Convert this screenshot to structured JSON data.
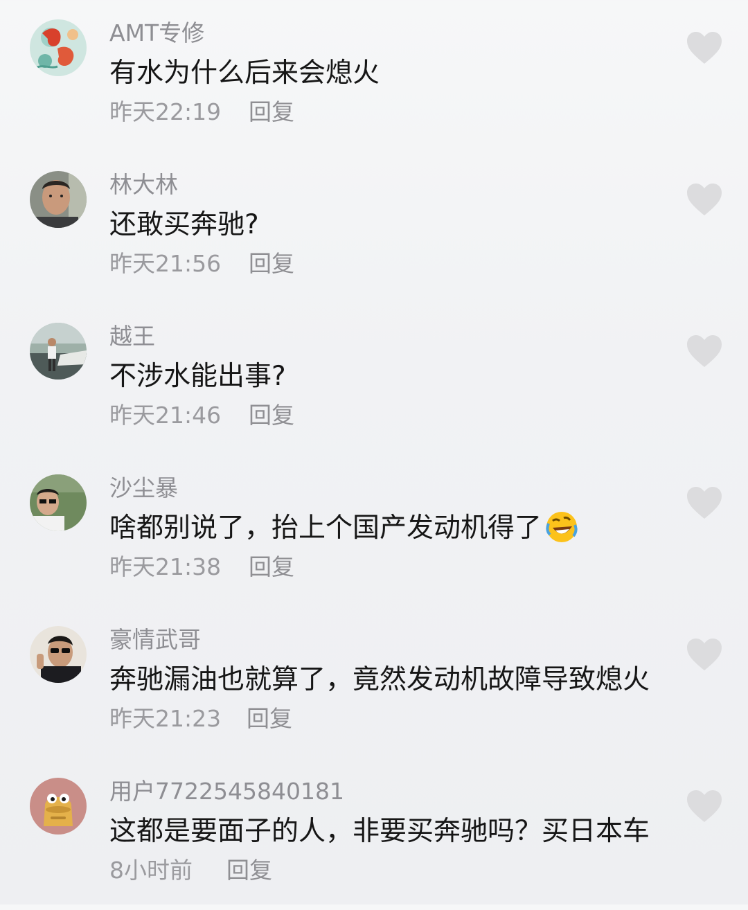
{
  "comments": [
    {
      "username": "AMT专修",
      "text": "有水为什么后来会熄火",
      "time": "昨天22:19",
      "reply": "回复",
      "avatar_icon": "koi-fish-painting"
    },
    {
      "username": "林大林",
      "text": "还敢买奔驰?",
      "time": "昨天21:56",
      "reply": "回复",
      "avatar_icon": "man-portrait"
    },
    {
      "username": "越王",
      "text": "不涉水能出事?",
      "time": "昨天21:46",
      "reply": "回复",
      "avatar_icon": "man-by-boat"
    },
    {
      "username": "沙尘暴",
      "text": "啥都别说了，抬上个国产发动机得了",
      "time": "昨天21:38",
      "reply": "回复",
      "avatar_icon": "man-with-glasses",
      "emoji_icon": "rolling-laughing-emoji"
    },
    {
      "username": "豪情武哥",
      "text": "奔驰漏油也就算了，竟然发动机故障导致熄火",
      "time": "昨天21:23",
      "reply": "回复",
      "avatar_icon": "man-in-sunglasses"
    },
    {
      "username": "用户7722545840181",
      "text": "这都是要面子的人，非要买奔驰吗？买日本车",
      "time": "8小时前",
      "reply": "回复",
      "avatar_icon": "cartoon-monster"
    }
  ],
  "like_icon": "heart-icon",
  "colors": {
    "username": "#8e8e93",
    "text": "#161616",
    "meta": "#9a9a9e",
    "heart": "#dcdcde"
  }
}
